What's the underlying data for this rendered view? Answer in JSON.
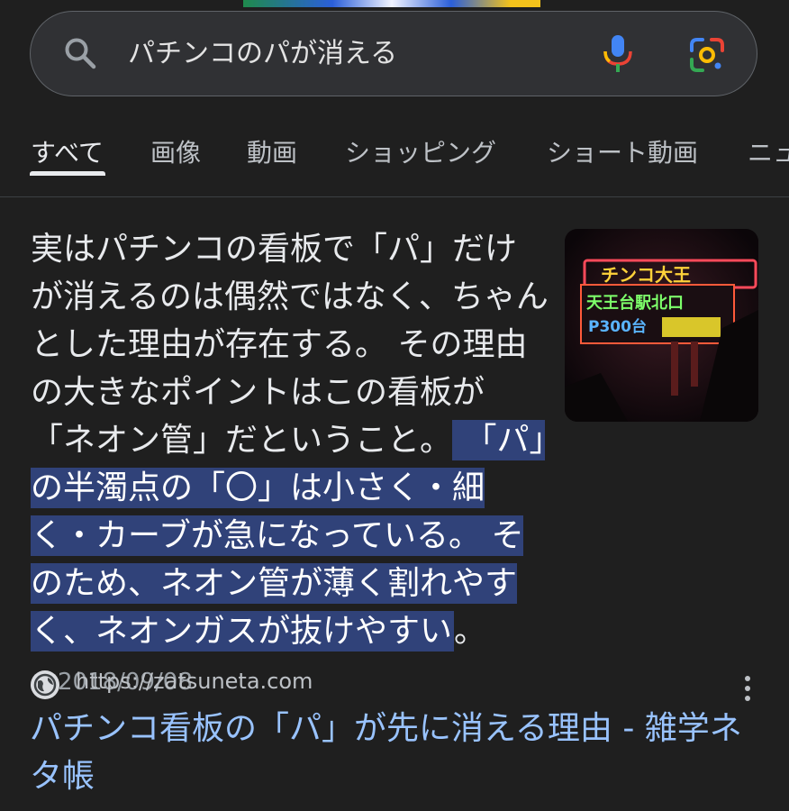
{
  "search": {
    "query": "パチンコのパが消える"
  },
  "tabs": [
    {
      "label": "すべて"
    },
    {
      "label": "画像"
    },
    {
      "label": "動画"
    },
    {
      "label": "ショッピング"
    },
    {
      "label": "ショート動画"
    },
    {
      "label": "ニュ"
    }
  ],
  "snippet": {
    "text_before_highlight": "実はパチンコの看板で「パ」だけが消えるのは偶然ではなく、ちゃんとした理由が存在する。 その理由の大きなポイントはこの看板が「ネオン管」だということ。",
    "highlight": " 「パ」の半濁点の「〇」は小さく・細く・カーブが急になっている。 そのため、ネオン管が薄く割れやすく、ネオンガスが抜けやすい",
    "text_after_highlight": "。",
    "date": "2018/09/08",
    "thumbnail": {
      "sign_line1": "チンコ大王",
      "sign_line2": "天王台駅北口",
      "sign_line3": "P300台"
    }
  },
  "result": {
    "url": "https://zatsuneta.com",
    "title": "パチンコ看板の「パ」が先に消える理由 - 雑学ネタ帳"
  },
  "colors": {
    "background": "#1f1f1f",
    "highlight": "#304279",
    "link": "#99c3ff"
  }
}
